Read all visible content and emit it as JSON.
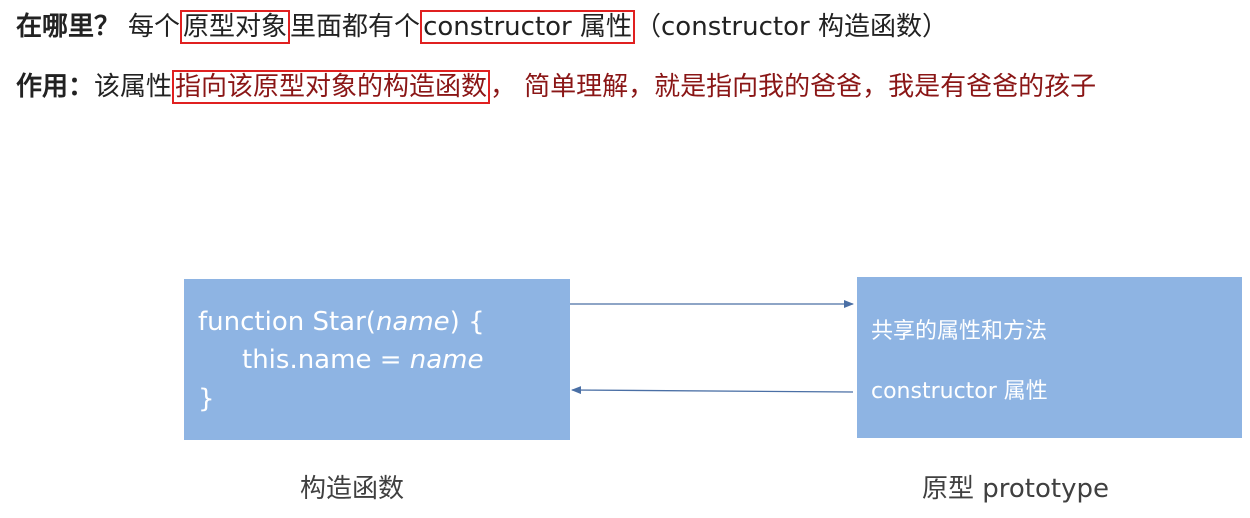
{
  "line1": {
    "label": "在哪里？",
    "text_a": "每个",
    "boxed_a": "原型对象",
    "text_b": "里面都有个",
    "boxed_b": "constructor 属性",
    "text_c": "（constructor 构造函数）"
  },
  "line2": {
    "label": "作用：",
    "text_a": "该属性",
    "boxed_a": "指向该原型对象的构造函数",
    "text_b": "，",
    "text_c": "简单理解，就是指向我的爸爸，我是有爸爸的孩子"
  },
  "constructor_box": {
    "code_line1_a": "function Star(",
    "code_line1_param": "name",
    "code_line1_b": ") {",
    "code_line2_a": "this.name = ",
    "code_line2_param": "name",
    "code_line3": "}"
  },
  "prototype_box": {
    "item1": "共享的属性和方法",
    "item2": "constructor 属性"
  },
  "captions": {
    "constructor": "构造函数",
    "prototype": "原型 prototype"
  },
  "colors": {
    "box_fill": "#8eb4e3",
    "highlight_border": "#e02020",
    "emphasis_text": "#8a1616",
    "arrow": "#4a6fa5"
  }
}
